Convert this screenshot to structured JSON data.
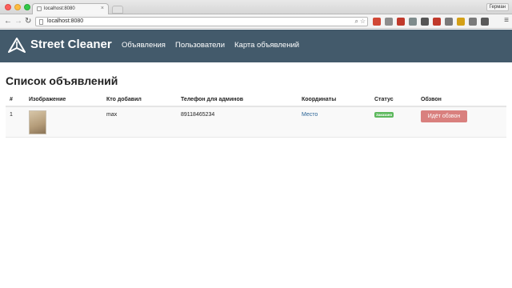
{
  "browser": {
    "tab_title": "localhost:8080",
    "profile_name": "Герман",
    "url": "localhost:8080"
  },
  "extensions": [
    {
      "name": "gmail-icon",
      "color": "#d14836"
    },
    {
      "name": "puzzle-icon",
      "color": "#8e8e8e"
    },
    {
      "name": "video-icon",
      "color": "#c0392b"
    },
    {
      "name": "clock-icon",
      "color": "#7f8c8d"
    },
    {
      "name": "camera-icon",
      "color": "#555555"
    },
    {
      "name": "bookmark-icon",
      "color": "#c0392b"
    },
    {
      "name": "chart-icon",
      "color": "#7a7a7a"
    },
    {
      "name": "shield-icon",
      "color": "#d4a017"
    },
    {
      "name": "gear-icon",
      "color": "#7a7a7a"
    },
    {
      "name": "note-icon",
      "color": "#5a5a5a"
    }
  ],
  "app": {
    "brand": "Street Cleaner",
    "nav": [
      "Объявления",
      "Пользователи",
      "Карта объявлений"
    ]
  },
  "page": {
    "title": "Список объявлений",
    "columns": [
      "#",
      "Изображение",
      "Кто добавил",
      "Телефон для админов",
      "Координаты",
      "Статус",
      "Обзвон"
    ],
    "rows": [
      {
        "id": "1",
        "author": "max",
        "phone": "89118465234",
        "coords": "Место",
        "status": "Заказано",
        "action": "Идёт обзвон"
      }
    ]
  },
  "colors": {
    "navbar": "#435a6b",
    "status_badge": "#5cb85c",
    "action_button": "#d9807e",
    "link": "#2a6496"
  }
}
